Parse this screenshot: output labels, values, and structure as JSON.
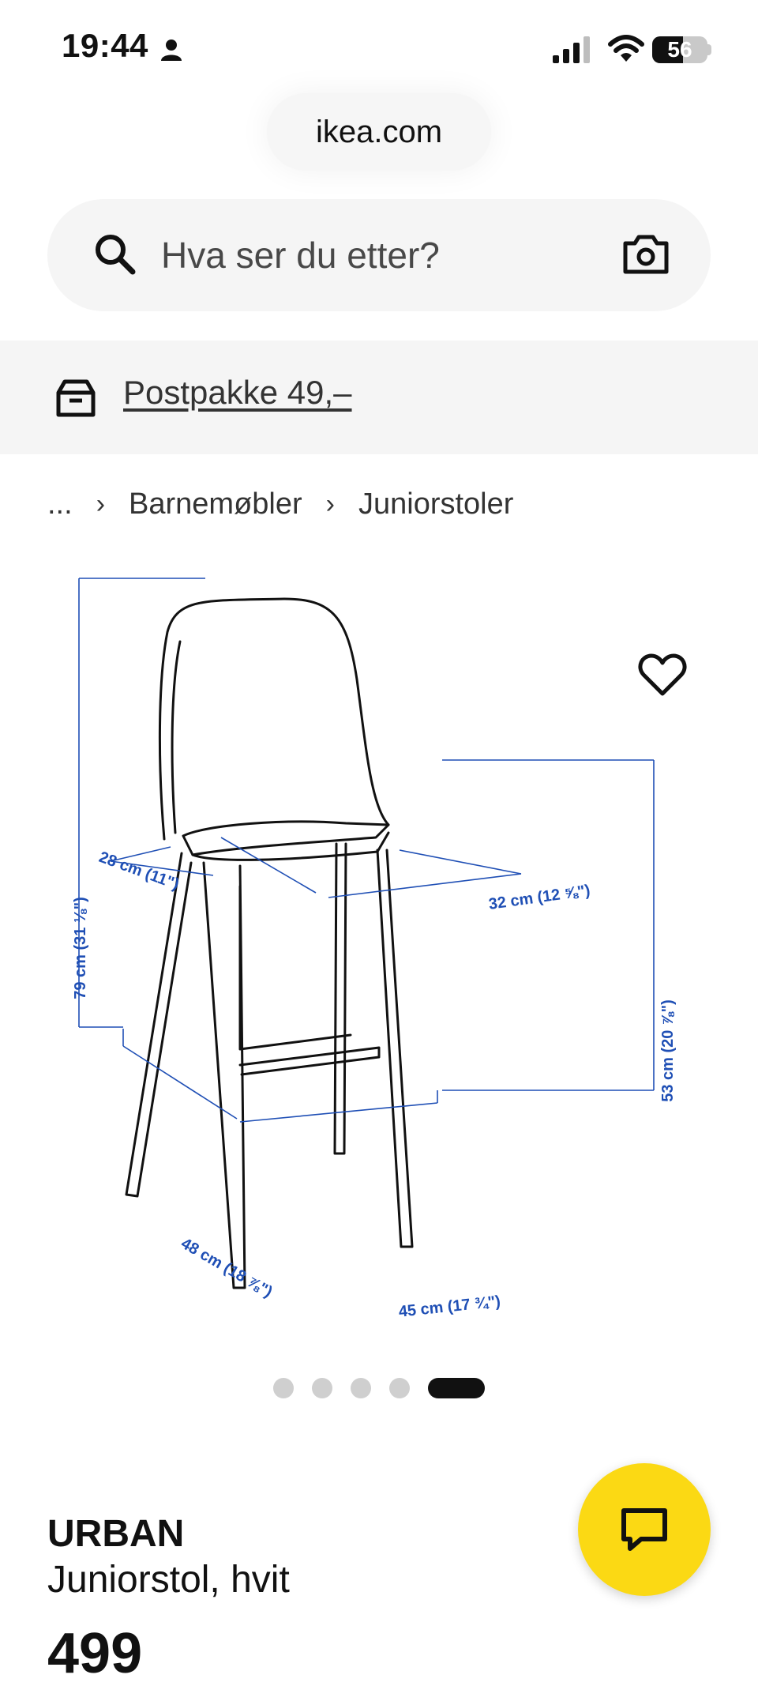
{
  "status_bar": {
    "time": "19:44",
    "battery": "56",
    "battery_level": 0.56
  },
  "browser": {
    "url": "ikea.com"
  },
  "search": {
    "placeholder": "Hva ser du etter?"
  },
  "delivery": {
    "label": "Postpakke 49,–"
  },
  "breadcrumb": {
    "items": [
      "...",
      "Barnemøbler",
      "Juniorstoler"
    ]
  },
  "product_image": {
    "dimensions": {
      "height": "79 cm (31 ⅛\")",
      "seat_depth": "28 cm (11\")",
      "seat_width": "32 cm (12 ⅝\")",
      "seat_height": "53 cm (20 ⅞\")",
      "depth": "48 cm (18 ⅞\")",
      "width": "45 cm (17 ¾\")"
    },
    "dimension_color": "#1f4fb5",
    "carousel": {
      "count": 5,
      "active_index": 4
    }
  },
  "product": {
    "name": "URBAN",
    "description": "Juniorstol, hvit",
    "price": "499"
  },
  "colors": {
    "accent": "#fbd914"
  },
  "icons": {
    "person": "person-icon",
    "signal": "signal-icon",
    "wifi": "wifi-icon",
    "search": "search-icon",
    "camera": "camera-icon",
    "parcel": "parcel-icon",
    "heart": "heart-icon",
    "chat": "chat-icon"
  }
}
